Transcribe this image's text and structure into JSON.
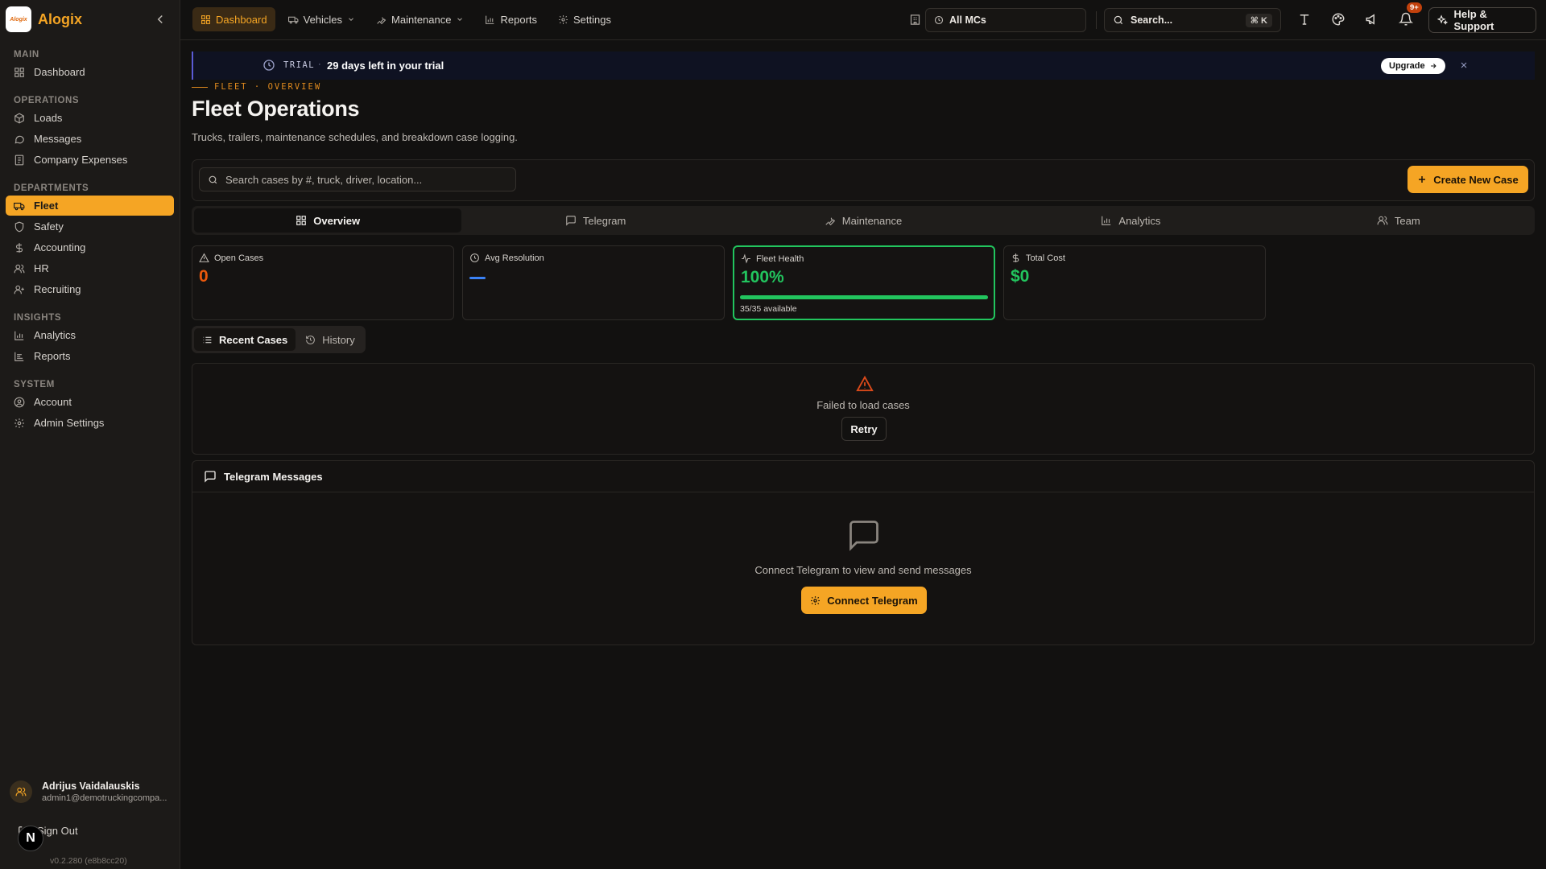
{
  "brand": {
    "name": "Alogix",
    "logo_text": "Alogix"
  },
  "sidebar": {
    "sections": [
      {
        "title": "Main",
        "items": [
          {
            "label": "Dashboard",
            "icon": "grid-icon"
          }
        ]
      },
      {
        "title": "Operations",
        "items": [
          {
            "label": "Loads",
            "icon": "package-icon"
          },
          {
            "label": "Messages",
            "icon": "message-icon"
          },
          {
            "label": "Company Expenses",
            "icon": "receipt-icon"
          }
        ]
      },
      {
        "title": "Departments",
        "items": [
          {
            "label": "Fleet",
            "icon": "truck-icon",
            "active": true
          },
          {
            "label": "Safety",
            "icon": "shield-icon"
          },
          {
            "label": "Accounting",
            "icon": "dollar-icon"
          },
          {
            "label": "HR",
            "icon": "users-icon"
          },
          {
            "label": "Recruiting",
            "icon": "user-plus-icon"
          }
        ]
      },
      {
        "title": "Insights",
        "items": [
          {
            "label": "Analytics",
            "icon": "bar-chart-icon"
          },
          {
            "label": "Reports",
            "icon": "reports-icon"
          }
        ]
      },
      {
        "title": "System",
        "items": [
          {
            "label": "Account",
            "icon": "user-circle-icon"
          },
          {
            "label": "Admin Settings",
            "icon": "gear-icon"
          }
        ]
      }
    ],
    "user": {
      "name": "Adrijus Vaidalauskis",
      "email": "admin1@demotruckingcompa..."
    },
    "sign_out": "Sign Out",
    "version": "v0.2.280 (e8b8cc20)",
    "n_badge": "N"
  },
  "topnav": {
    "items": [
      {
        "label": "Dashboard",
        "active": true
      },
      {
        "label": "Vehicles",
        "dropdown": true
      },
      {
        "label": "Maintenance",
        "dropdown": true
      },
      {
        "label": "Reports"
      },
      {
        "label": "Settings"
      }
    ],
    "mc_select": "All MCs",
    "search_label": "Search...",
    "search_kbd": "⌘ K",
    "notif_count": "9+",
    "help_label": "Help & Support"
  },
  "trial": {
    "tag": "TRIAL",
    "separator": "·",
    "text": "29 days left in your trial",
    "upgrade": "Upgrade"
  },
  "page": {
    "eyebrow": "FLEET · OVERVIEW",
    "title": "Fleet Operations",
    "subtitle": "Trucks, trailers, maintenance schedules, and breakdown case logging.",
    "search_placeholder": "Search cases by #, truck, driver, location...",
    "create_label": "Create New Case"
  },
  "tabs": [
    {
      "label": "Overview",
      "active": true
    },
    {
      "label": "Telegram"
    },
    {
      "label": "Maintenance"
    },
    {
      "label": "Analytics"
    },
    {
      "label": "Team"
    }
  ],
  "stats": {
    "open_cases": {
      "label": "Open Cases",
      "value": "0",
      "color": "#ea580c"
    },
    "avg_resolution": {
      "label": "Avg Resolution",
      "value": ""
    },
    "fleet_health": {
      "label": "Fleet Health",
      "value": "100%",
      "fraction": 1.0,
      "note": "35/35 available",
      "color": "#22c55e"
    },
    "total_cost": {
      "label": "Total Cost",
      "value": "$0",
      "color": "#22c55e"
    }
  },
  "subtabs": [
    {
      "label": "Recent Cases",
      "active": true
    },
    {
      "label": "History"
    }
  ],
  "cases": {
    "error": "Failed to load cases",
    "retry": "Retry"
  },
  "telegram": {
    "title": "Telegram Messages",
    "empty": "Connect Telegram to view and send messages",
    "connect": "Connect Telegram"
  },
  "colors": {
    "accent": "#f5a524",
    "danger": "#dc4a1a",
    "success": "#22c55e",
    "info": "#3b82f6"
  }
}
